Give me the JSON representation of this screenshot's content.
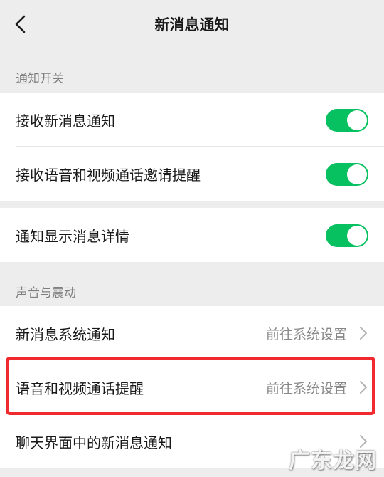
{
  "header": {
    "title": "新消息通知",
    "back_icon": "chevron-left-icon"
  },
  "sections": [
    {
      "label": "通知开关"
    },
    {
      "label": "声音与震动"
    }
  ],
  "notify_group": [
    {
      "label": "接收新消息通知",
      "toggle_on": true
    },
    {
      "label": "接收语音和视频通话邀请提醒",
      "toggle_on": true
    }
  ],
  "detail_group": [
    {
      "label": "通知显示消息详情",
      "toggle_on": true
    }
  ],
  "sound_group": [
    {
      "label": "新消息系统通知",
      "value": "前往系统设置"
    },
    {
      "label": "语音和视频通话提醒",
      "value": "前往系统设置"
    },
    {
      "label": "聊天界面中的新消息通知",
      "value": ""
    }
  ],
  "watermark": "广东龙网",
  "colors": {
    "accent": "#07c160",
    "highlight": "#f02a2f",
    "background": "#ededed"
  }
}
